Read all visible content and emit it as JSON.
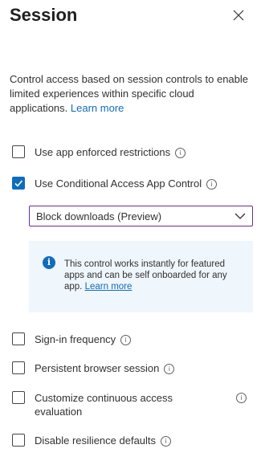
{
  "header": {
    "title": "Session",
    "close_icon": "close-icon"
  },
  "description": {
    "text": "Control access based on session controls to enable limited experiences within specific cloud applications.",
    "link": "Learn more"
  },
  "controls": [
    {
      "label": "Use app enforced restrictions",
      "checked": false
    },
    {
      "label": "Use Conditional Access App Control",
      "checked": true
    },
    {
      "label": "Sign-in frequency",
      "checked": false
    },
    {
      "label": "Persistent browser session",
      "checked": false
    },
    {
      "label": "Customize continuous access evaluation",
      "checked": false
    },
    {
      "label": "Disable resilience defaults",
      "checked": false
    }
  ],
  "app_control_select": {
    "value": "Block downloads (Preview)"
  },
  "infobox": {
    "text": "This control works instantly for featured apps and can be self onboarded for any app.",
    "link": "Learn more"
  },
  "colors": {
    "accent": "#0f6cbd",
    "infobox_bg": "#eff6fc",
    "select_border": "#6b2e8a"
  }
}
